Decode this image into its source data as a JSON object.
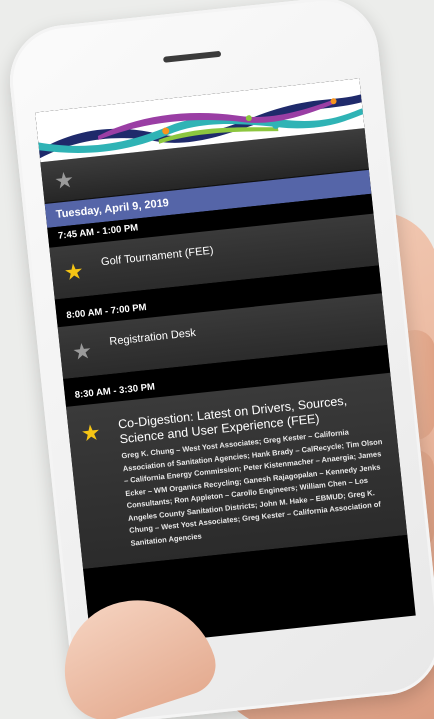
{
  "app": {
    "date": "Tuesday, April 9, 2019"
  },
  "events": [
    {
      "time": "7:45 AM - 1:00 PM",
      "starred": true,
      "star_icon": "star-icon",
      "title": "Golf Tournament (FEE)",
      "description": ""
    },
    {
      "time": "8:00 AM - 7:00 PM",
      "starred": false,
      "star_icon": "star-icon",
      "title": "Registration Desk",
      "description": ""
    },
    {
      "time": "8:30 AM - 3:30 PM",
      "starred": true,
      "star_icon": "star-icon",
      "title": "Co-Digestion: Latest on Drivers, Sources, Science and User Experience (FEE)",
      "description": "Greg K. Chung – West Yost Associates; Greg Kester – California Association of Sanitation Agencies; Hank Brady – CalRecycle; Tim Olson – California Energy Commission; Peter Kistenmacher – Anaergia; James Ecker – WM Organics Recycling; Ganesh Rajagopalan – Kennedy Jenks Consultants; Ron Appleton – Carollo Engineers; William Chen – Los Angeles County Sanitation Districts; John M. Hake – EBMUD; Greg K. Chung – West Yost Associates; Greg Kester – California Association of Sanitation Agencies"
    }
  ],
  "colors": {
    "date_bar": "#5565a8",
    "star_active": "#f6c514",
    "star_inactive": "#9a9a9a"
  }
}
